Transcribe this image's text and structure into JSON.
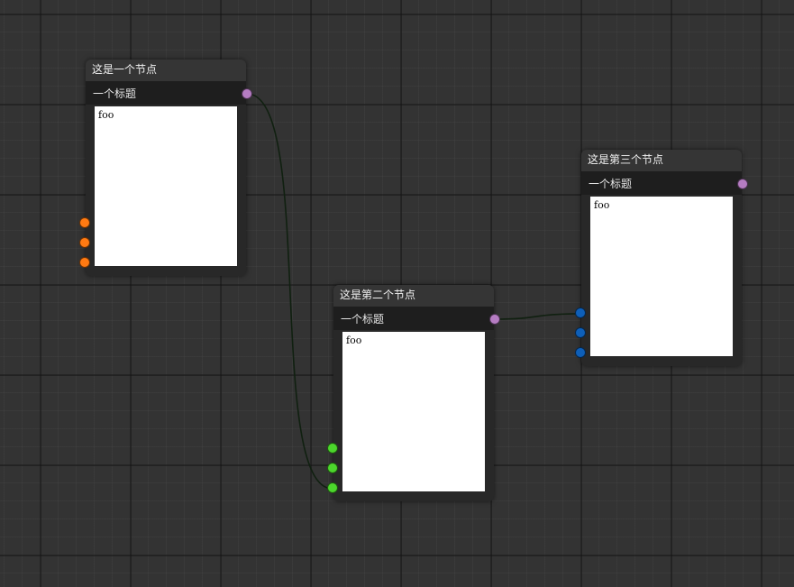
{
  "colors": {
    "background": "#333333",
    "node_header": "#353535",
    "node_subtitle": "#1e1e1e",
    "node_body": "#282828",
    "wire": "#102010",
    "output_port": "#b57cc2",
    "node1_inputs": "#ff7a12",
    "node2_inputs": "#4cd62c",
    "node3_inputs": "#0e5fb8"
  },
  "nodes": [
    {
      "title": "这是一个节点",
      "subtitle": "一个标题",
      "text": "foo",
      "input_port_color": "#ff7a12",
      "input_count": 3,
      "output_count": 1
    },
    {
      "title": "这是第二个节点",
      "subtitle": "一个标题",
      "text": "foo",
      "input_port_color": "#4cd62c",
      "input_count": 3,
      "output_count": 1
    },
    {
      "title": "这是第三个节点",
      "subtitle": "一个标题",
      "text": "foo",
      "input_port_color": "#0e5fb8",
      "input_count": 3,
      "output_count": 1
    }
  ],
  "connections": [
    {
      "from_node": 0,
      "from_output": 0,
      "to_node": 1,
      "to_input": 2
    },
    {
      "from_node": 1,
      "from_output": 0,
      "to_node": 2,
      "to_input": 0
    }
  ]
}
